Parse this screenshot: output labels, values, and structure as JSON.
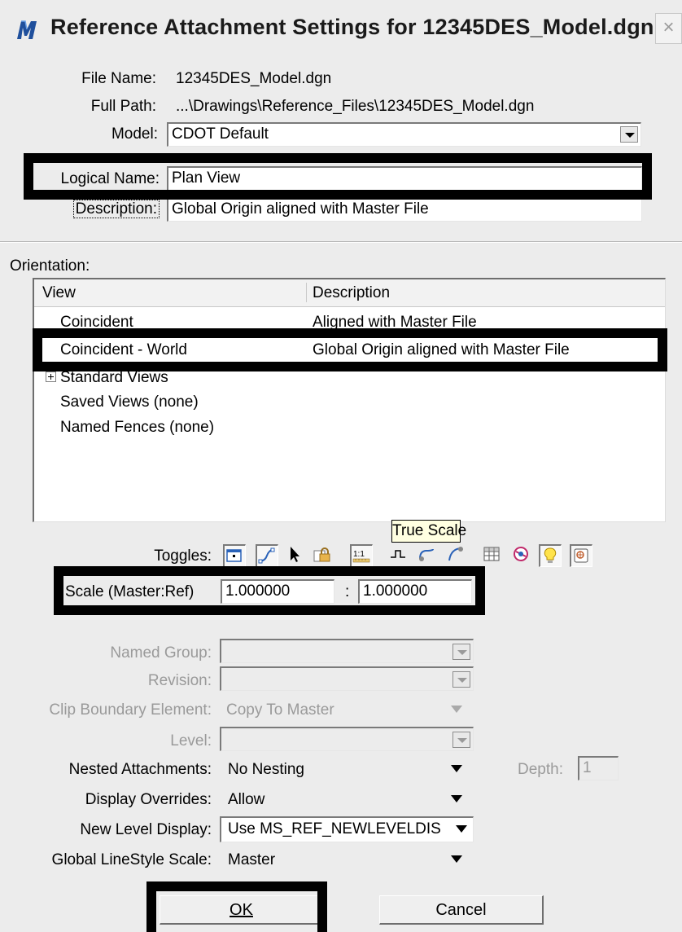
{
  "window": {
    "title": "Reference Attachment Settings for 12345DES_Model.dgn",
    "close_symbol": "×"
  },
  "file": {
    "file_name_label": "File Name:",
    "file_name": "12345DES_Model.dgn",
    "full_path_label": "Full Path:",
    "full_path": "...\\Drawings\\Reference_Files\\12345DES_Model.dgn",
    "model_label": "Model:",
    "model": "CDOT Default",
    "logical_name_label": "Logical Name:",
    "logical_name": "Plan View",
    "description_label": "Description:",
    "description": "Global Origin aligned with Master File"
  },
  "orientation": {
    "label": "Orientation:",
    "columns": [
      "View",
      "Description"
    ],
    "rows": [
      {
        "view": "Coincident",
        "description": "Aligned with Master File"
      },
      {
        "view": "Coincident - World",
        "description": "Global Origin aligned with Master File"
      },
      {
        "view": "Standard Views",
        "description": ""
      },
      {
        "view": "Saved Views (none)",
        "description": ""
      },
      {
        "view": "Named Fences (none)",
        "description": ""
      }
    ]
  },
  "toggles": {
    "label": "Toggles:",
    "icons": [
      "display-toggle-icon",
      "snap-toggle-icon",
      "locate-toggle-icon",
      "lock-toggle-icon",
      "true-scale-icon",
      "scale-line-styles-icon",
      "ignore-attachment-icon",
      "treat-as-element-icon",
      "level-display-icon",
      "georeference-icon",
      "light-bulb-icon",
      "display-raster-icon"
    ],
    "true_scale_glyph": "1:1",
    "tooltip": "True Scale"
  },
  "scale": {
    "label": "Scale (Master:Ref)",
    "master": "1.000000",
    "separator": ":",
    "ref": "1.000000"
  },
  "settings": {
    "named_group_label": "Named Group:",
    "named_group": "",
    "revision_label": "Revision:",
    "revision": "",
    "clip_boundary_label": "Clip Boundary Element:",
    "clip_boundary": "Copy To Master",
    "level_label": "Level:",
    "level": "",
    "nested_label": "Nested Attachments:",
    "nested": "No Nesting",
    "depth_label": "Depth:",
    "depth": "1",
    "display_overrides_label": "Display Overrides:",
    "display_overrides": "Allow",
    "new_level_label": "New Level Display:",
    "new_level": "Use MS_REF_NEWLEVELDIS",
    "linestyle_label": "Global LineStyle Scale:",
    "linestyle": "Master"
  },
  "buttons": {
    "ok": "OK",
    "cancel": "Cancel"
  },
  "colors": {
    "dialog_bg": "#ececec",
    "highlight_frame": "#000000",
    "tooltip_bg": "#ffffe1"
  }
}
